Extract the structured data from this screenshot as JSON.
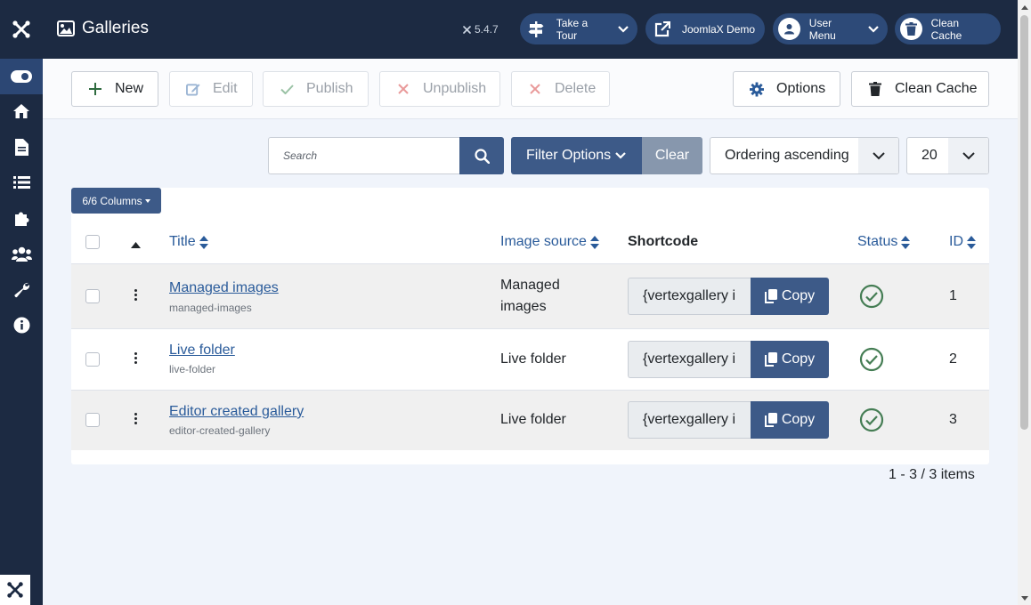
{
  "header": {
    "title": "Galleries",
    "version": "5.4.7",
    "buttons": [
      {
        "label": "Take a Tour",
        "icon": "signpost-icon"
      },
      {
        "label": "JoomlaX Demo",
        "icon": "external-link-icon"
      },
      {
        "label": "User Menu",
        "icon": "user-icon"
      },
      {
        "label": "Clean Cache",
        "icon": "trash-icon"
      }
    ]
  },
  "toolbar": {
    "new": "New",
    "edit": "Edit",
    "publish": "Publish",
    "unpublish": "Unpublish",
    "delete": "Delete",
    "options": "Options",
    "clean_cache": "Clean Cache"
  },
  "filters": {
    "search_placeholder": "Search",
    "filter_options": "Filter Options",
    "clear": "Clear",
    "ordering": "Ordering ascending",
    "limit": "20"
  },
  "table": {
    "columns_button": "6/6 Columns",
    "headers": {
      "title": "Title",
      "image_source": "Image source",
      "shortcode": "Shortcode",
      "status": "Status",
      "id": "ID"
    },
    "copy_label": "Copy",
    "rows": [
      {
        "title": "Managed images",
        "alias": "managed-images",
        "source": "Managed images",
        "shortcode": "{vertexgallery i",
        "id": "1"
      },
      {
        "title": "Live folder",
        "alias": "live-folder",
        "source": "Live folder",
        "shortcode": "{vertexgallery i",
        "id": "2"
      },
      {
        "title": "Editor created gallery",
        "alias": "editor-created-gallery",
        "source": "Live folder",
        "shortcode": "{vertexgallery i",
        "id": "3"
      }
    ]
  },
  "pagination": {
    "summary": "1 - 3 / 3 items"
  },
  "colors": {
    "sidebar": "#1c2a42",
    "primary": "#3d5a88",
    "link": "#2a5b9a",
    "success": "#457d54"
  }
}
